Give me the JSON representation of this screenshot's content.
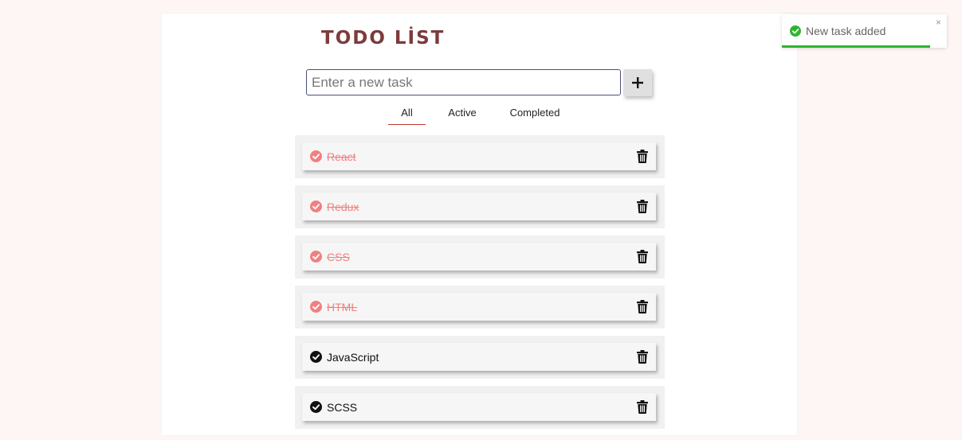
{
  "app": {
    "title": "TODO LİST"
  },
  "input": {
    "placeholder": "Enter a new task",
    "value": ""
  },
  "add_button": {
    "icon": "plus-icon"
  },
  "filters": [
    {
      "label": "All",
      "active": true
    },
    {
      "label": "Active",
      "active": false
    },
    {
      "label": "Completed",
      "active": false
    }
  ],
  "todos": [
    {
      "text": "React",
      "completed": true
    },
    {
      "text": "Redux",
      "completed": true
    },
    {
      "text": "CSS",
      "completed": true
    },
    {
      "text": "HTML",
      "completed": true
    },
    {
      "text": "JavaScript",
      "completed": false
    },
    {
      "text": "SCSS",
      "completed": false
    }
  ],
  "toast": {
    "message": "New task added",
    "close_label": "×",
    "progress": 0.9,
    "icon": "check-circle-icon"
  },
  "colors": {
    "background": "#fdf6f4",
    "title": "#7d3b3b",
    "completed_text": "#f08080",
    "active_tab_underline": "#c0392b",
    "toast_success": "#2db52d"
  }
}
